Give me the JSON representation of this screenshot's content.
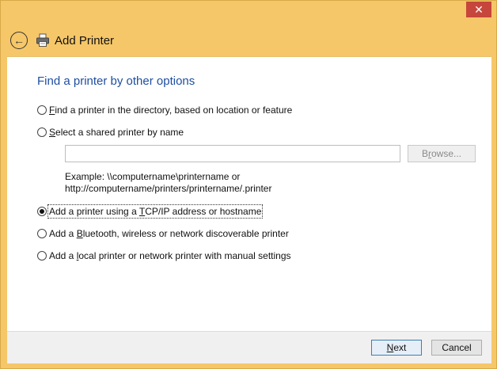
{
  "window": {
    "title": "Add Printer",
    "close_glyph": "✕"
  },
  "header": {
    "back_glyph": "←",
    "icon": "printer-icon"
  },
  "main": {
    "heading": "Find a printer by other options",
    "options": [
      {
        "pre": "",
        "key": "F",
        "post": "ind a printer in the directory, based on location or feature",
        "checked": false
      },
      {
        "pre": "",
        "key": "S",
        "post": "elect a shared printer by name",
        "checked": false
      },
      {
        "pre": "Add a printer using a ",
        "key": "T",
        "post": "CP/IP address or hostname",
        "checked": true
      },
      {
        "pre": "Add a ",
        "key": "B",
        "post": "luetooth, wireless or network discoverable printer",
        "checked": false
      },
      {
        "pre": "Add a ",
        "key": "l",
        "post": "ocal printer or network printer with manual settings",
        "checked": false
      }
    ],
    "shared_printer_input": {
      "value": "",
      "placeholder": ""
    },
    "browse": {
      "pre": "B",
      "key": "r",
      "post": "owse..."
    },
    "example_line1": "Example: \\\\computername\\printername or",
    "example_line2": "http://computername/printers/printername/.printer"
  },
  "footer": {
    "next": {
      "key": "N",
      "post": "ext"
    },
    "cancel": "Cancel"
  },
  "colors": {
    "title_bar": "#f6c768",
    "heading": "#1e4fa0",
    "close": "#c7463c"
  }
}
